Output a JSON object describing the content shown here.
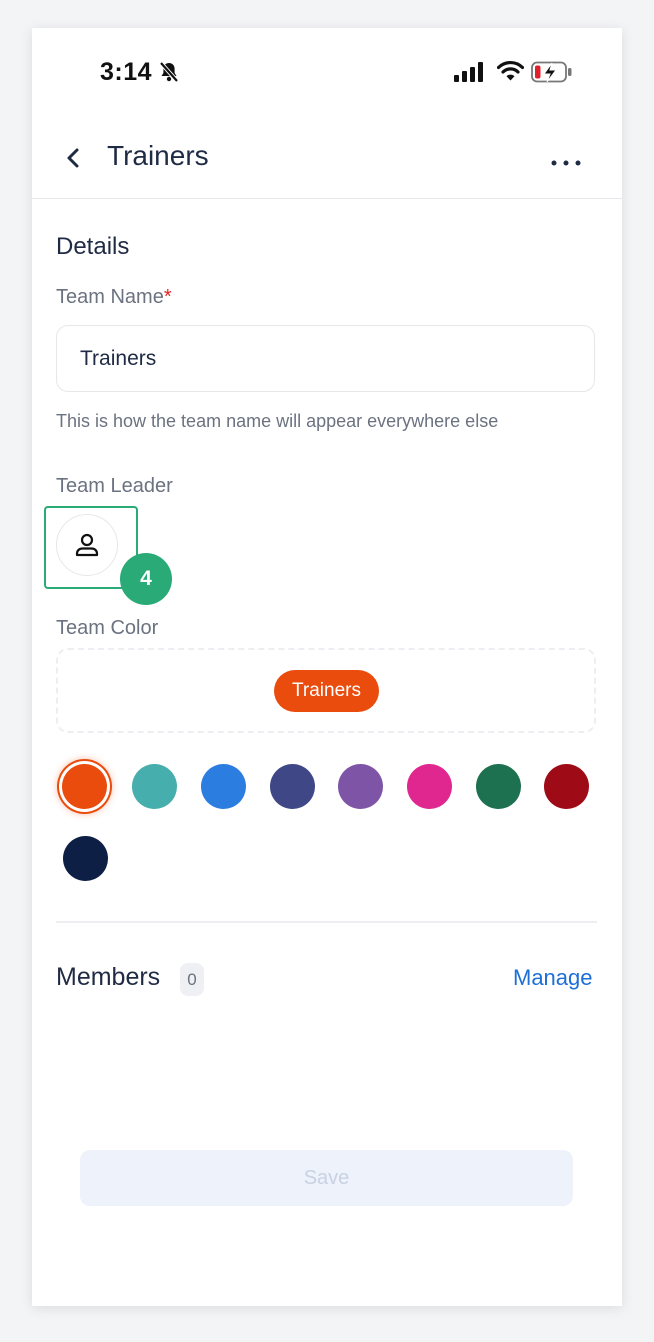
{
  "status_bar": {
    "time": "3:14"
  },
  "navbar": {
    "title": "Trainers"
  },
  "details": {
    "section_title": "Details",
    "team_name_label": "Team Name",
    "required_mark": "*",
    "team_name_value": "Trainers",
    "team_name_hint": "This is how the team name will appear everywhere else",
    "team_leader_label": "Team Leader",
    "step_badge": "4",
    "team_color_label": "Team Color",
    "preview_chip": "Trainers",
    "colors": [
      "#ea4c0e",
      "#46aeac",
      "#2c7de0",
      "#3f4786",
      "#7e55a6",
      "#e02790",
      "#1d7150",
      "#9e0a16",
      "#0e1f45"
    ],
    "selected_color": "#ea4c0e"
  },
  "members": {
    "title": "Members",
    "count": "0",
    "manage_label": "Manage"
  },
  "save_label": "Save",
  "icons": [
    "bell-slash-icon",
    "signal-icon",
    "wifi-icon",
    "battery-charging-icon",
    "chevron-left-icon",
    "more-horizontal-icon",
    "user-icon"
  ]
}
